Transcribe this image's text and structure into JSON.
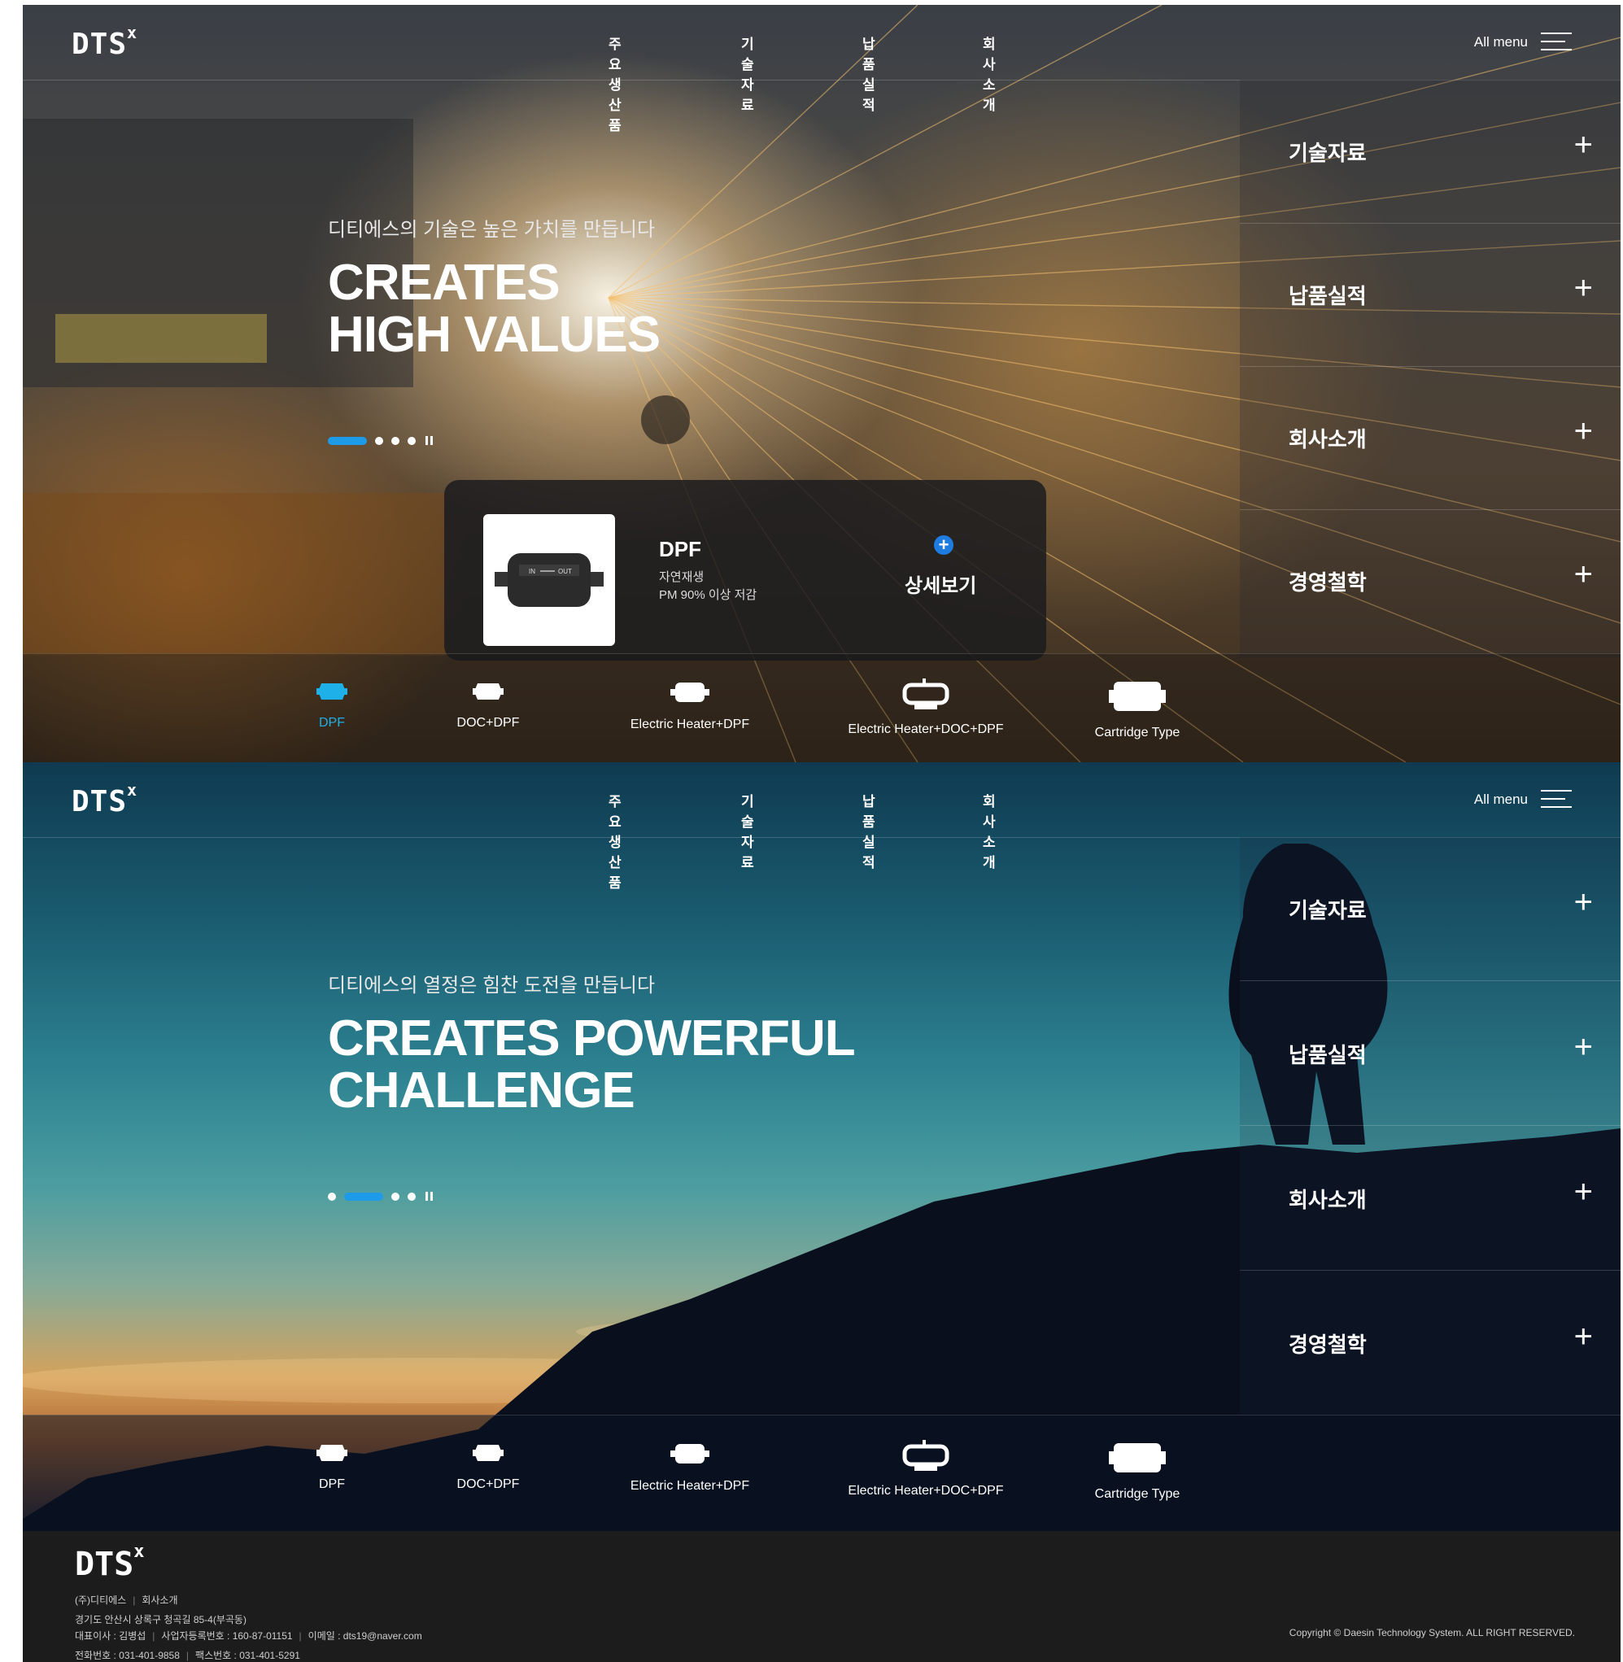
{
  "header": {
    "logo": "DTS",
    "logo_mark": "x",
    "nav": [
      "주요생산품",
      "기술자료",
      "납품실적",
      "회사소개"
    ],
    "all_menu": "All menu"
  },
  "slides": [
    {
      "subtitle": "디티에스의 기술은 높은 가치를 만듭니다",
      "title_line1": "CREATES",
      "title_line2": "HIGH VALUES",
      "indicator_active": 1
    },
    {
      "subtitle": "디티에스의 열정은 힘찬 도전을 만듭니다",
      "title_line1": "CREATES POWERFUL",
      "title_line2": "CHALLENGE",
      "indicator_active": 2
    }
  ],
  "side_menu": [
    "기술자료",
    "납품실적",
    "회사소개",
    "경영철학"
  ],
  "side_menu_plus": "+",
  "product_card": {
    "name": "DPF",
    "desc1": "자연재생",
    "desc2": "PM 90% 이상 저감",
    "thumb_in": "IN",
    "thumb_out": "OUT",
    "more_icon": "+",
    "more_label": "상세보기"
  },
  "products": [
    {
      "label": "DPF",
      "icon": "dpf-icon"
    },
    {
      "label": "DOC+DPF",
      "icon": "doc-dpf-icon"
    },
    {
      "label": "Electric Heater+DPF",
      "icon": "electric-heater-dpf-icon"
    },
    {
      "label": "Electric Heater+DOC+DPF",
      "icon": "electric-heater-doc-dpf-icon"
    },
    {
      "label": "Cartridge Type",
      "icon": "cartridge-icon"
    }
  ],
  "footer": {
    "logo": "DTS",
    "logo_mark": "x",
    "links": [
      "(주)디티에스",
      "회사소개"
    ],
    "address": "경기도 안산시 상록구 청곡길 85-4(부곡동)",
    "ceo": "대표이사 : 김병섭",
    "biz_no": "사업자등록번호 : 160-87-01151",
    "email": "이메일 : dts19@naver.com",
    "tel": "전화번호 : 031-401-9858",
    "fax": "팩스번호 : 031-401-5291",
    "copyright": "Copyright © Daesin Technology System. ALL RIGHT RESERVED."
  },
  "colors": {
    "accent": "#1e9be8",
    "product_active": "#1eb0e8",
    "footer_bg": "#1c1c1c"
  }
}
